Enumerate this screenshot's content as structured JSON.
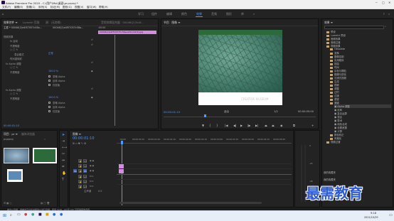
{
  "window": {
    "title": "Adobe Premiere Pro 2020 - C:\\用户\\Msi\\桌面\\pr.prproj *"
  },
  "menu": [
    "文件(F)",
    "编辑(E)",
    "剪辑(C)",
    "序列(S)",
    "标记(M)",
    "图形(G)",
    "视图(V)",
    "窗口(W)",
    "帮助(H)"
  ],
  "workspaces": [
    "学习",
    "组件",
    "编辑",
    "颜色",
    "效果",
    "音频",
    "图形",
    "库"
  ],
  "active_workspace": "效果",
  "effect_controls": {
    "tabs": [
      "效果控件 ≡",
      "Lumetri 范围",
      "源：(无剪辑)",
      "音频剪辑混合器：00046(2)7e4f..."
    ],
    "source_label": "主要 * 00046(2)e4f57057c58a...",
    "clip_label": "00046(2)e4f57057c58a...",
    "timecode_head": ":00:00",
    "clip_bar": "00046(2)e4f570575c56aea5b/c22(9).jpg",
    "rows": [
      {
        "label": "视频效果",
        "kind": "header"
      },
      {
        "label": "fx 运动",
        "kind": "fx"
      },
      {
        "label": "不透明度",
        "kind": "sub"
      },
      {
        "label": "混合模式",
        "kind": "sub2",
        "value": "正常"
      },
      {
        "label": "时间重映射",
        "kind": "fx"
      },
      {
        "label": "fx Alpha 调整",
        "kind": "fx"
      },
      {
        "label": "不透明度",
        "kind": "sub",
        "value": "100.0 %"
      },
      {
        "label": "忽略 Alpha",
        "kind": "check"
      },
      {
        "label": "反转 Alpha",
        "kind": "check"
      },
      {
        "label": "仅蒙版",
        "kind": "check"
      },
      {
        "label": "fx Alpha 调整",
        "kind": "fx"
      },
      {
        "label": "不透明度",
        "kind": "sub",
        "value": "100.0 %"
      },
      {
        "label": "忽略 Alpha",
        "kind": "check"
      },
      {
        "label": "反转 Alpha",
        "kind": "check"
      },
      {
        "label": "仅蒙版",
        "kind": "check"
      }
    ],
    "footer_time": "00:00:01:10"
  },
  "program_monitor": {
    "tab": "节目：图像 ≡",
    "timecode_left": "00:00:01:10",
    "fit": "适合",
    "quality": "1/2",
    "timecode_right": "00:00:05:00",
    "watermark": "CREATIVE MUSEUM"
  },
  "project": {
    "tabs": [
      "项目：pr ≡",
      "媒体浏览器"
    ],
    "items_label": "pr.prproj"
  },
  "timeline": {
    "tab": "图像 ≡",
    "timecode": "00:00:01:10",
    "ruler": [
      ":00:00",
      "00:00:00:10",
      "00:00:01:00",
      "00:00:01:10",
      "00:00:02:00",
      "00:00:02:10",
      "00:00:03:00",
      "00:00:03:10",
      "00:00:04:00",
      "00:00:04:10",
      "00:00:05:00",
      "00:00:05:10"
    ],
    "tracks": [
      "V3",
      "V2",
      "V1",
      "A1",
      "A2",
      "A3"
    ],
    "master": "主声道",
    "master_val": "0.0"
  },
  "effects_panel": {
    "tab": "效果 ≡",
    "tree": [
      "预设",
      "Lumetri 预设",
      "音频效果",
      "音频过渡",
      "视频效果",
      "Obsolete",
      "变换",
      "图像控制",
      "实用程序",
      "扭曲",
      "时间",
      "杂色与颗粒",
      "模糊与锐化",
      "沉浸式视频",
      "生成",
      "视频",
      "调整",
      "过时",
      "过渡",
      "透视",
      "通道",
      "Alpha 调整",
      "反转",
      "复合运算",
      "混合",
      "算术",
      "纯色合成",
      "设置遮罩",
      "计算",
      "颜色校正",
      "风格化",
      "视频过渡"
    ],
    "selected": "Alpha 调整",
    "footer": [
      "我的收藏夹",
      "我的收藏夹"
    ]
  },
  "status": {
    "text": "单击以选择，或单击空白处并拖动以进行选择。使用 Shift、Alt 和 Ctrl 可获得其他选项。"
  },
  "overlay_brand": "最需教育",
  "taskbar": {
    "time": "9:18",
    "date": "2021/10/29"
  },
  "colors": {
    "accent": "#4b9bff",
    "clip": "#d48ce0",
    "video_green": "#2d6a3a"
  }
}
